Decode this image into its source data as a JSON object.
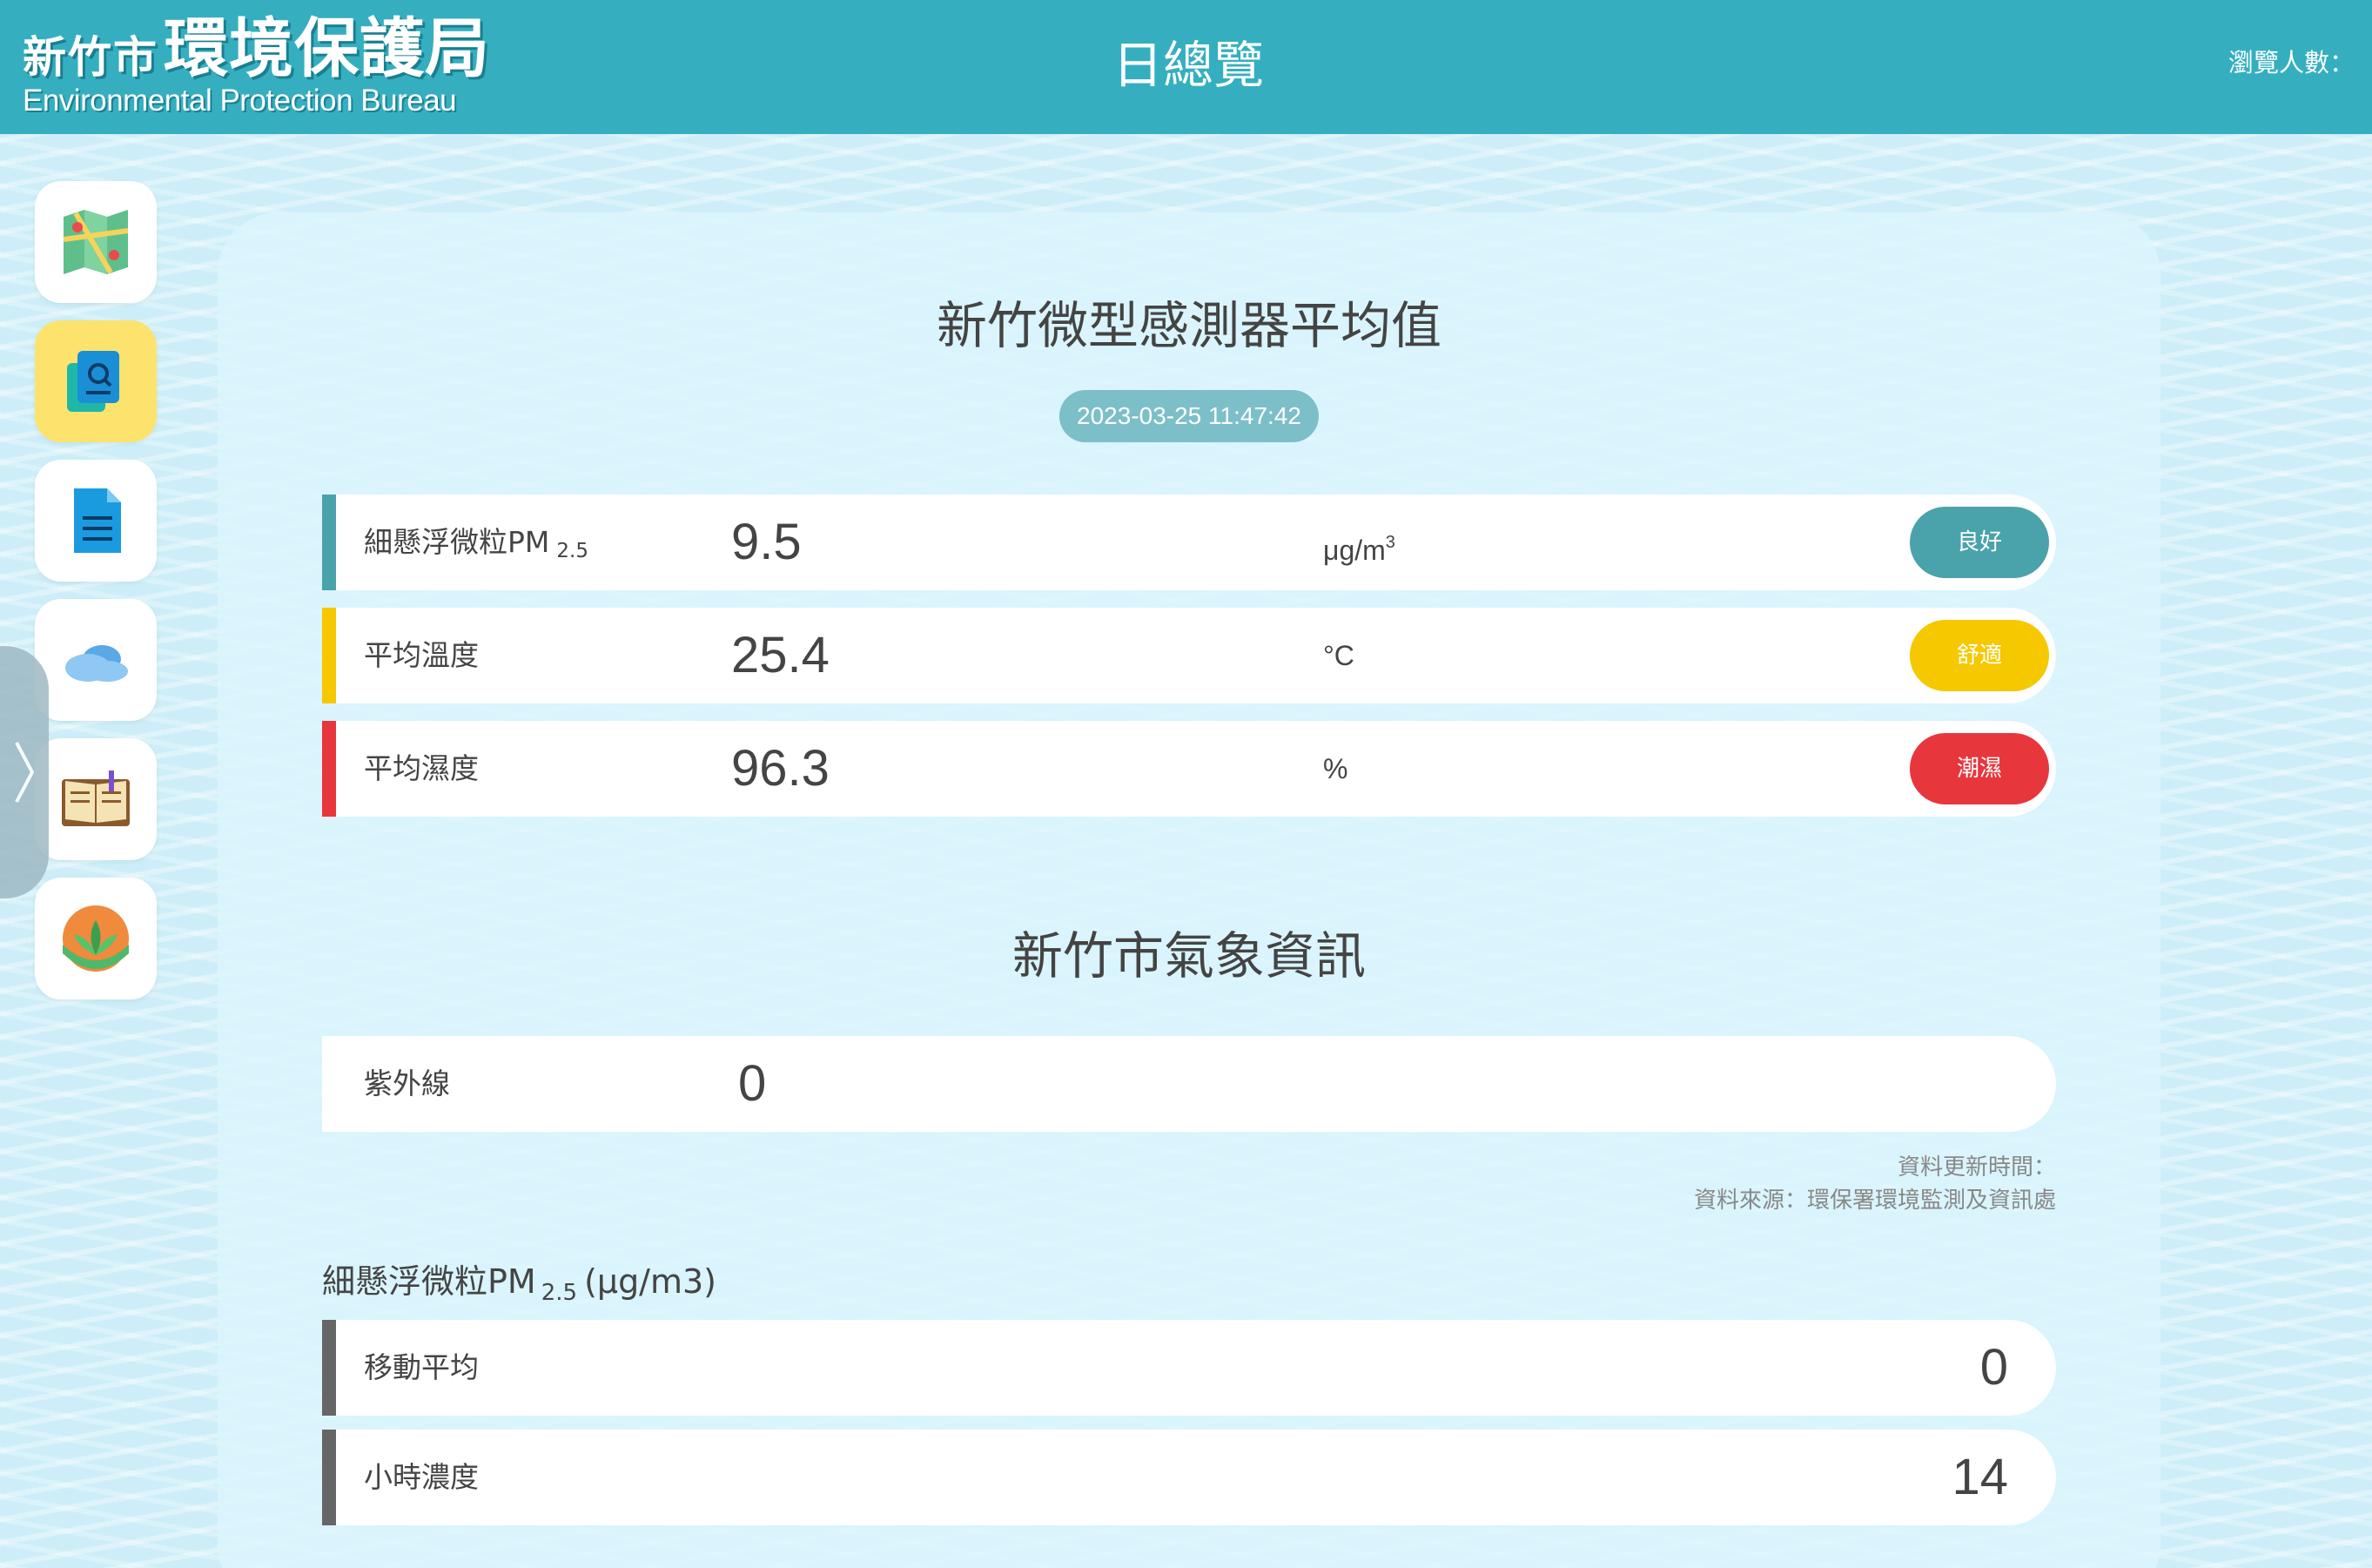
{
  "header": {
    "logo_city": "新竹市",
    "logo_agency": "環境保護局",
    "logo_en": "Environmental Protection Bureau",
    "title": "日總覽",
    "visitors_label": "瀏覽人數："
  },
  "sidebar": {
    "items": [
      {
        "icon": "map-icon",
        "active": false
      },
      {
        "icon": "document-search-icon",
        "active": true
      },
      {
        "icon": "document-icon",
        "active": false
      },
      {
        "icon": "cloud-icon",
        "active": false
      },
      {
        "icon": "book-icon",
        "active": false
      },
      {
        "icon": "eco-leaf-icon",
        "active": false
      }
    ],
    "toggle_icon": "chevron-right-icon"
  },
  "sensor_section": {
    "title": "新竹微型感測器平均值",
    "timestamp": "2023-03-25 11:47:42",
    "rows": [
      {
        "label": "細懸浮微粒PM",
        "label_sub": "2.5",
        "value": "9.5",
        "unit": "μg/m",
        "unit_sup": "3",
        "status": "良好",
        "color": "#4aa3ab"
      },
      {
        "label": "平均溫度",
        "value": "25.4",
        "unit": "°C",
        "status": "舒適",
        "color": "#f5c800"
      },
      {
        "label": "平均濕度",
        "value": "96.3",
        "unit": "%",
        "status": "潮濕",
        "color": "#e8363d"
      }
    ]
  },
  "weather_section": {
    "title": "新竹市氣象資訊",
    "uv_label": "紫外線",
    "uv_value": "0",
    "update_time_label": "資料更新時間：",
    "source_label": "資料來源：環保署環境監測及資訊處"
  },
  "pm25_section": {
    "heading": "細懸浮微粒PM",
    "heading_sub": "2.5",
    "heading_unit": "(μg/m3)",
    "rows": [
      {
        "label": "移動平均",
        "value": "0"
      },
      {
        "label": "小時濃度",
        "value": "14"
      }
    ],
    "bar_color": "#666666"
  }
}
